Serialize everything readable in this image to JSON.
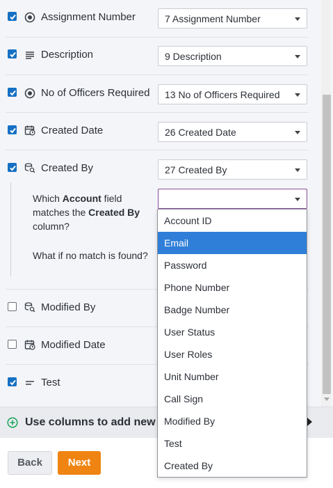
{
  "fields": [
    {
      "name": "Assignment Number",
      "icon": "radio-icon",
      "checked": true,
      "value": "7 Assignment Number"
    },
    {
      "name": "Description",
      "icon": "text-lines-icon",
      "checked": true,
      "value": "9 Description"
    },
    {
      "name": "No of Officers Required",
      "icon": "radio-icon",
      "checked": true,
      "value": "13 No of Officers Required"
    },
    {
      "name": "Created Date",
      "icon": "calendar-icon",
      "checked": true,
      "value": "26 Created Date"
    },
    {
      "name": "Created By",
      "icon": "user-search-icon",
      "checked": true,
      "value": "27 Created By"
    },
    {
      "name": "Modified By",
      "icon": "user-search-icon",
      "checked": false,
      "value": ""
    },
    {
      "name": "Modified Date",
      "icon": "calendar-icon",
      "checked": false,
      "value": ""
    },
    {
      "name": "Test",
      "icon": "short-text-icon",
      "checked": true,
      "value": ""
    }
  ],
  "created_by_sub": {
    "question1_pre": "Which ",
    "question1_bold1": "Account",
    "question1_mid": " field matches the ",
    "question1_bold2": "Created By",
    "question1_post": " column?",
    "match_field_value": "",
    "question2": "What if no match is found?"
  },
  "dropdown": {
    "options": [
      "Account ID",
      "Email",
      "Password",
      "Phone Number",
      "Badge Number",
      "User Status",
      "User Roles",
      "Unit Number",
      "Call Sign",
      "Modified By",
      "Test",
      "Created By"
    ],
    "highlighted": "Email"
  },
  "add_bar": {
    "label": "Use columns to add new"
  },
  "footer": {
    "back_label": "Back",
    "next_label": "Next"
  },
  "colors": {
    "accent": "#1570c4",
    "highlight": "#2f7fd8",
    "next_button": "#ef8412",
    "focus_border": "#8a4c9a"
  }
}
